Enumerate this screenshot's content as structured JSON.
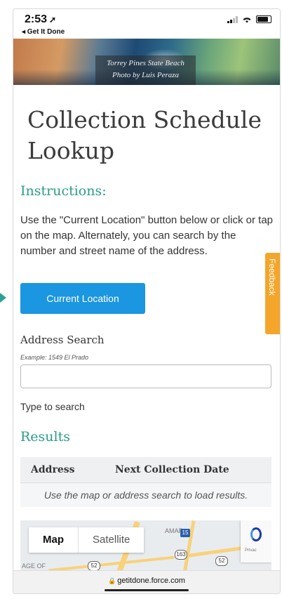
{
  "status_bar": {
    "time": "2:53",
    "back_label": "◂ Get It Done"
  },
  "hero": {
    "caption_line1": "Torrey Pines State Beach",
    "caption_line2": "Photo by Luis Peraza"
  },
  "page": {
    "title": "Collection Schedule Lookup",
    "instructions_heading": "Instructions:",
    "instructions_text": "Use the \"Current Location\" button below or click or tap on the map. Alternately, you can search by the number and street name of the address.",
    "current_location_button": "Current Location",
    "feedback_tab": "Feedback",
    "address_search_label": "Address Search",
    "address_example": "Example: 1549 El Prado",
    "address_input": {
      "value": "",
      "placeholder": ""
    },
    "type_hint": "Type to search",
    "results_heading": "Results",
    "results_table": {
      "headers": [
        "Address",
        "Next Collection Date"
      ],
      "empty_message": "Use the map or address search to load results."
    }
  },
  "map": {
    "tabs": [
      "Map",
      "Satellite"
    ],
    "active_tab": "Map",
    "labels": [
      "AMAR",
      "AGE OF"
    ],
    "route_numbers": [
      "163",
      "52",
      "52",
      "15"
    ],
    "recaptcha_text": "Privac"
  },
  "browser": {
    "url": "getitdone.force.com"
  },
  "colors": {
    "accent_green": "#2a9d86",
    "button_blue": "#1b96e0",
    "feedback_orange": "#f4a62a"
  }
}
